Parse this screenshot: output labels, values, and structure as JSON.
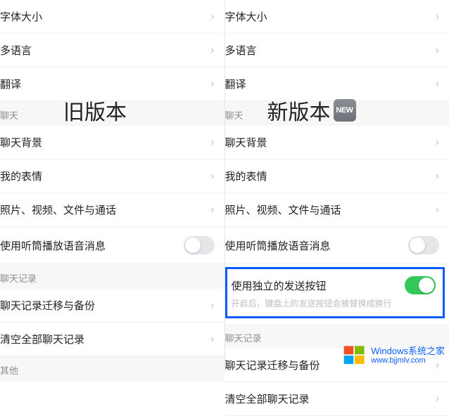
{
  "left": {
    "overlay": "旧版本",
    "items": {
      "fontSize": "字体大小",
      "language": "多语言",
      "translate": "翻译",
      "chatSection": "聊天",
      "chatBg": "聊天背景",
      "myStickers": "我的表情",
      "media": "照片、视频、文件与通话",
      "earpiece": "使用听筒播放语音消息",
      "historySection": "聊天记录",
      "migrate": "聊天记录迁移与备份",
      "clearAll": "清空全部聊天记录",
      "otherSection": "其他"
    }
  },
  "right": {
    "overlay": "新版本",
    "newBadge": "NEW",
    "items": {
      "fontSize": "字体大小",
      "language": "多语言",
      "translate": "翻译",
      "chatSection": "聊天",
      "chatBg": "聊天背景",
      "myStickers": "我的表情",
      "media": "照片、视频、文件与通话",
      "earpiece": "使用听筒播放语音消息",
      "sendButton": "使用独立的发送按钮",
      "sendButtonDesc": "开启后，键盘上的发送按钮会被替换成换行",
      "historySection": "聊天记录",
      "migrate": "聊天记录迁移与备份",
      "clearAll": "清空全部聊天记录"
    }
  },
  "watermark": {
    "title": "Windows系统之家",
    "url": "www.bjjmlv.com"
  }
}
